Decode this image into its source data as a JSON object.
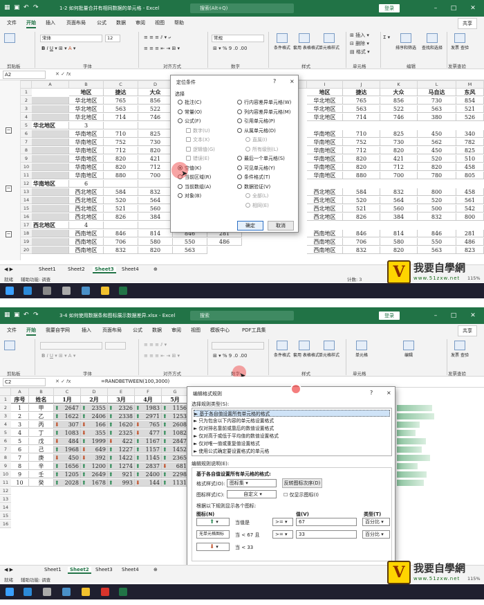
{
  "s1": {
    "title": "1-2 如何批量合并有相同数据的单元格  -  Excel",
    "search": "搜索(Alt+Q)",
    "login": "登录",
    "tabs": [
      "文件",
      "开始",
      "插入",
      "页面布局",
      "公式",
      "数据",
      "审阅",
      "视图",
      "帮助"
    ],
    "share": "共享",
    "font_name": "宋体",
    "font_size": "12",
    "number_format": "常规",
    "groups": [
      "剪贴板",
      "字体",
      "对齐方式",
      "数字",
      "样式",
      "单元格",
      "编辑",
      "发票查验"
    ],
    "big_buttons": [
      "条件格式",
      "套用\n表格格式",
      "单元格样式",
      "插入",
      "删除",
      "格式",
      "排序和筛选",
      "查找和选择",
      "发票\n查验"
    ],
    "name_box": "A2",
    "col_headers": [
      "A",
      "B",
      "C",
      "D",
      "E",
      "F",
      "G",
      "H",
      "I",
      "J",
      "K",
      "L",
      "M",
      "N"
    ],
    "headers_row": [
      "地区",
      "捷达",
      "大众",
      "",
      "",
      "地区",
      "捷达",
      "大众",
      "马自达",
      "东风"
    ],
    "rows_left": [
      [
        "2",
        "",
        "华北地区",
        "765",
        "856"
      ],
      [
        "3",
        "",
        "华北地区",
        "563",
        "522"
      ],
      [
        "4",
        "",
        "华北地区",
        "714",
        "746"
      ],
      [
        "5",
        "华北地区",
        "3",
        "",
        ""
      ],
      [
        "6",
        "",
        "华南地区",
        "710",
        "825"
      ],
      [
        "7",
        "",
        "华南地区",
        "752",
        "730"
      ],
      [
        "8",
        "",
        "华南地区",
        "712",
        "820"
      ],
      [
        "9",
        "",
        "华南地区",
        "820",
        "421"
      ],
      [
        "10",
        "",
        "华南地区",
        "820",
        "712"
      ],
      [
        "11",
        "",
        "华南地区",
        "880",
        "700"
      ],
      [
        "12",
        "华南地区",
        "6",
        "",
        ""
      ],
      [
        "13",
        "",
        "西北地区",
        "584",
        "832"
      ],
      [
        "14",
        "",
        "西北地区",
        "520",
        "564"
      ],
      [
        "15",
        "",
        "西北地区",
        "521",
        "560"
      ],
      [
        "16",
        "",
        "西北地区",
        "826",
        "384"
      ],
      [
        "17",
        "西北地区",
        "4",
        "",
        ""
      ],
      [
        "18",
        "",
        "西南地区",
        "846",
        "814",
        "846",
        "281"
      ],
      [
        "19",
        "",
        "西南地区",
        "706",
        "580",
        "550",
        "486"
      ],
      [
        "20",
        "",
        "西南地区",
        "832",
        "820",
        "563"
      ]
    ],
    "rows_right": [
      [
        "华北地区",
        "765",
        "856",
        "730",
        "854"
      ],
      [
        "华北地区",
        "563",
        "522",
        "563",
        "521"
      ],
      [
        "华北地区",
        "714",
        "746",
        "380",
        "526"
      ],
      [
        "",
        "",
        "",
        "",
        ""
      ],
      [
        "华南地区",
        "710",
        "825",
        "450",
        "340"
      ],
      [
        "华南地区",
        "752",
        "730",
        "562",
        "782"
      ],
      [
        "华南地区",
        "712",
        "820",
        "450",
        "825"
      ],
      [
        "华南地区",
        "820",
        "421",
        "520",
        "510"
      ],
      [
        "华南地区",
        "820",
        "712",
        "820",
        "458"
      ],
      [
        "华南地区",
        "880",
        "700",
        "780",
        "805"
      ],
      [
        "",
        "",
        "",
        "",
        ""
      ],
      [
        "西北地区",
        "584",
        "832",
        "800",
        "458"
      ],
      [
        "西北地区",
        "520",
        "564",
        "520",
        "561"
      ],
      [
        "西北地区",
        "521",
        "560",
        "500",
        "542"
      ],
      [
        "西北地区",
        "826",
        "384",
        "832",
        "800"
      ],
      [
        "",
        "",
        "",
        "",
        ""
      ],
      [
        "西南地区",
        "846",
        "814",
        "846",
        "281"
      ],
      [
        "西南地区",
        "706",
        "580",
        "550",
        "486"
      ],
      [
        "西南地区",
        "832",
        "820",
        "563",
        "823"
      ]
    ],
    "dialog": {
      "title": "定位条件",
      "question": "?",
      "close": "×",
      "section": "选择",
      "left_opts": [
        "批注(C)",
        "常量(O)",
        "公式(F)",
        "数字(U)",
        "文本(X)",
        "逻辑值(G)",
        "错误(E)",
        "空值(K)",
        "当前区域(R)",
        "当前数组(A)",
        "对象(B)"
      ],
      "right_opts": [
        "行内容差异单元格(W)",
        "列内容差异单元格(M)",
        "引用单元格(P)",
        "从属单元格(D)",
        "直属(I)",
        "所有级别(L)",
        "最后一个单元格(S)",
        "可见单元格(Y)",
        "条件格式(T)",
        "数据验证(V)",
        "全部(L)",
        "相同(E)"
      ],
      "ok": "确定",
      "cancel": "取消"
    },
    "sheets": [
      "Sheet1",
      "Sheet2",
      "Sheet3",
      "Sheet4"
    ],
    "status_left": "就绪",
    "status_access": "辅助功能: 调查",
    "status_count": "计数: 3",
    "zoom": "115%"
  },
  "s2": {
    "title": "3-4 如何使用数据条和图标展示数据差异.xlsx  -  Excel",
    "search": "搜索",
    "login": "登录",
    "tabs": [
      "文件",
      "开始",
      "我要自学网",
      "插入",
      "页面布局",
      "公式",
      "数据",
      "审阅",
      "视图",
      "模板中心",
      "PDF工具集"
    ],
    "share": "共享",
    "groups": [
      "剪贴板",
      "字体",
      "对齐方式",
      "数字",
      "样式",
      "单元格",
      "发票查验"
    ],
    "big_buttons": [
      "条件格式",
      "套用\n表格格式",
      "单元格样式",
      "单元格",
      "编辑",
      "发票\n查验"
    ],
    "name_box": "C2",
    "formula": "=RANDBETWEEN(100,3000)",
    "col_headers": [
      "A",
      "B",
      "C",
      "D",
      "E",
      "F",
      "G",
      "H",
      "I",
      "J",
      "K",
      "L",
      "M",
      "N",
      "O",
      "P",
      "Q"
    ],
    "table_header": [
      "序号",
      "姓名",
      "1月",
      "2月",
      "3月",
      "4月",
      "5月"
    ],
    "rows": [
      [
        "1",
        "甲",
        "2647",
        "2355",
        "2326",
        "1983",
        "1156"
      ],
      [
        "2",
        "乙",
        "1622",
        "2406",
        "2338",
        "2971",
        "1253"
      ],
      [
        "3",
        "丙",
        "307",
        "166",
        "1620",
        "765",
        "2608"
      ],
      [
        "4",
        "丁",
        "1083",
        "355",
        "2325",
        "477",
        "1082"
      ],
      [
        "5",
        "戊",
        "484",
        "1999",
        "422",
        "1167",
        "2847"
      ],
      [
        "6",
        "己",
        "1968",
        "649",
        "1227",
        "1157",
        "1452"
      ],
      [
        "7",
        "庚",
        "450",
        "392",
        "1422",
        "1145",
        "2365"
      ],
      [
        "8",
        "辛",
        "1656",
        "1200",
        "1274",
        "2837",
        "681"
      ],
      [
        "9",
        "壬",
        "1205",
        "2649",
        "921",
        "2400",
        "2298"
      ],
      [
        "10",
        "癸",
        "2028",
        "1678",
        "993",
        "144",
        "1131"
      ]
    ],
    "icons": [
      [
        "up",
        "up",
        "up",
        "up",
        "up"
      ],
      [
        "up",
        "up",
        "up",
        "up",
        "up"
      ],
      [
        "dn",
        "dn",
        "up",
        "dn",
        "up"
      ],
      [
        "up",
        "dn",
        "up",
        "dn",
        "up"
      ],
      [
        "dn",
        "up",
        "dn",
        "up",
        "up"
      ],
      [
        "up",
        "dn",
        "up",
        "up",
        "up"
      ],
      [
        "dn",
        "dn",
        "up",
        "up",
        "up"
      ],
      [
        "up",
        "up",
        "up",
        "up",
        "dn"
      ],
      [
        "up",
        "up",
        "up",
        "up",
        "up"
      ],
      [
        "up",
        "up",
        "up",
        "dn",
        "up"
      ]
    ],
    "dialog": {
      "title": "编辑格式规则",
      "question": "?",
      "close": "×",
      "rule_type_label": "选择规则类型(S):",
      "rule_types": [
        "► 基于各自值设置所有单元格的格式",
        "► 只为包含以下内容的单元格设置格式",
        "► 仅对排名靠前或靠后的数值设置格式",
        "► 仅对高于或低于平均值的数值设置格式",
        "► 仅对唯一值或重复值设置格式",
        "► 使用公式确定要设置格式的单元格"
      ],
      "desc_label": "编辑规则说明(E):",
      "desc_title": "基于各自值设置所有单元格的格式:",
      "style_label": "格式样式(O):",
      "style_value": "图标集",
      "reverse": "反转图标次序(D)",
      "iconstyle_label": "图标样式(C):",
      "iconstyle_value": "自定义",
      "show_icon_only": "仅显示图标(I)",
      "rule_intro": "根据以下规则显示各个图标:",
      "col_icon": "图标(N)",
      "col_value": "值(V)",
      "col_type": "类型(T)",
      "r1_when": "当值是",
      "r1_op": ">=",
      "r1_value": "67",
      "r1_type": "百分比",
      "r2_icon": "无单元格图标",
      "r2_when": "当 < 67 且",
      "r2_op": ">=",
      "r2_value": "33",
      "r2_type": "百分比",
      "r3_when": "当 < 33",
      "ok": "确定",
      "cancel": "取消"
    },
    "bars": [
      0.85,
      0.9,
      0.55,
      0.45,
      0.7,
      0.6,
      0.8,
      0.5,
      0.72,
      0.65
    ],
    "sheets": [
      "Sheet1",
      "Sheet2",
      "Sheet3",
      "Sheet4"
    ],
    "status_left": "就绪",
    "status_access": "辅助功能: 调查",
    "zoom": "115%"
  },
  "watermark": {
    "title": "我要自學網",
    "url": "www.51zxw.net",
    "logo": "V"
  }
}
